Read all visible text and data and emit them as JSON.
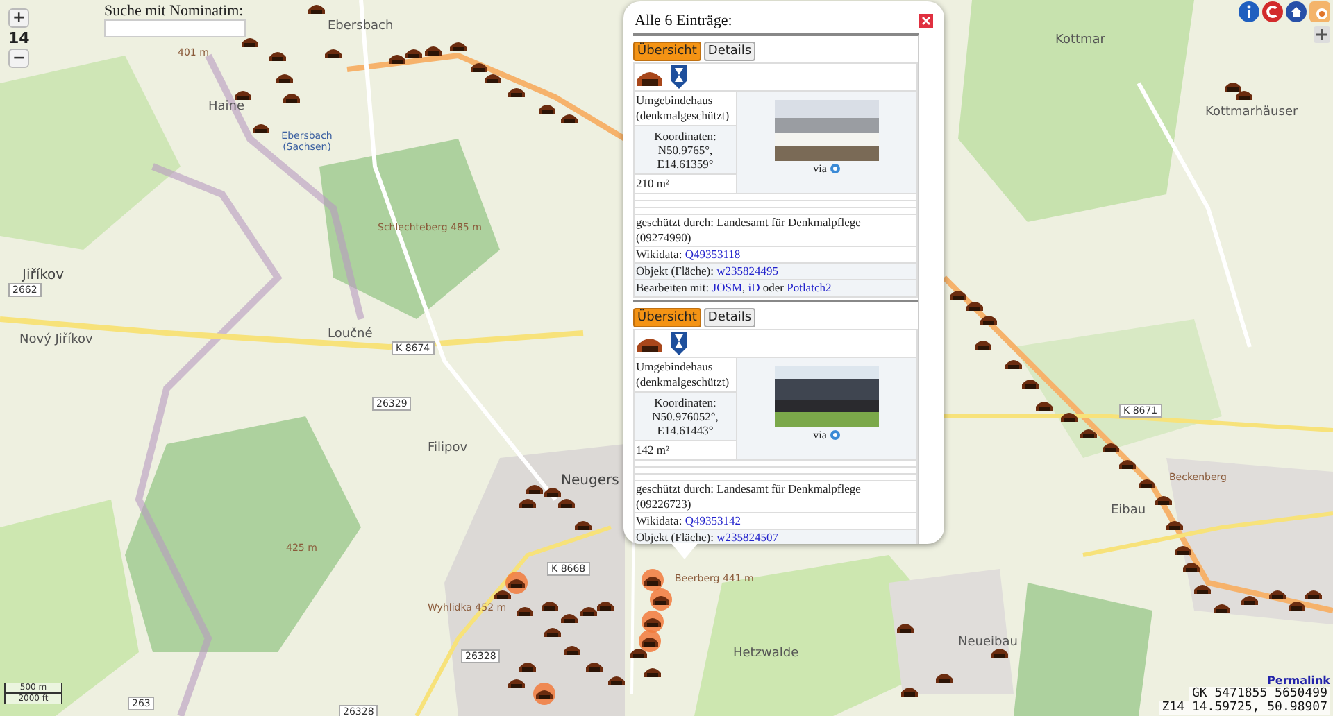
{
  "zoom_control": {
    "zoom_in": "+",
    "level": "14",
    "zoom_out": "−"
  },
  "search": {
    "label": "Suche mit Nominatim:"
  },
  "map": {
    "labels": [
      {
        "kind": "peak",
        "text": "401 m"
      },
      {
        "kind": "place",
        "text": "Haine"
      },
      {
        "kind": "place",
        "text": "Ebersbach"
      },
      {
        "kind": "poi",
        "text": "Ebersbach (Sachsen)"
      },
      {
        "kind": "peak",
        "text": "Schlechteberg 485 m"
      },
      {
        "kind": "town",
        "text": "Jiříkov"
      },
      {
        "kind": "ref",
        "text": "2662"
      },
      {
        "kind": "place",
        "text": "Nový Jiříkov"
      },
      {
        "kind": "place",
        "text": "Loučné"
      },
      {
        "kind": "ref",
        "text": "K 8674"
      },
      {
        "kind": "ref",
        "text": "26329"
      },
      {
        "kind": "place",
        "text": "Filipov"
      },
      {
        "kind": "town",
        "text": "Neugers"
      },
      {
        "kind": "peak",
        "text": "425 m"
      },
      {
        "kind": "ref",
        "text": "K 8668"
      },
      {
        "kind": "peak",
        "text": "Wyhlidka 452 m"
      },
      {
        "kind": "ref",
        "text": "26328"
      },
      {
        "kind": "ref",
        "text": "263"
      },
      {
        "kind": "ref",
        "text": "26328"
      },
      {
        "kind": "peak",
        "text": "Beerberg 441 m"
      },
      {
        "kind": "place",
        "text": "Hetzwalde"
      },
      {
        "kind": "place",
        "text": "Neueibau"
      },
      {
        "kind": "ref",
        "text": "K 8671"
      },
      {
        "kind": "place",
        "text": "Eibau"
      },
      {
        "kind": "peak",
        "text": "Beckenberg"
      },
      {
        "kind": "place",
        "text": "Kottmar"
      },
      {
        "kind": "place",
        "text": "Kottmarhäuser"
      }
    ]
  },
  "popup": {
    "title": "Alle 6 Einträge:",
    "entries": [
      {
        "tabs": [
          {
            "label": "Übersicht",
            "selected": true
          },
          {
            "label": "Details",
            "selected": false
          }
        ],
        "type": "Umgebindehaus (denkmalgeschützt)",
        "coordinates_label": "Koordinaten:",
        "latitude": "N50.9765°,",
        "longitude": "E14.61359°",
        "area": "210 m²",
        "image_via": "via",
        "protected_by": "geschützt durch: Landesamt für Denkmalpflege (09274990)",
        "wikidata_label": "Wikidata:",
        "wikidata_id": "Q49353118",
        "object_label": "Objekt (Fläche):",
        "object_id": "w235824495",
        "edit": [
          {
            "kind": "text",
            "text": "Bearbeiten mit:"
          },
          {
            "kind": "link",
            "text": "JOSM"
          },
          {
            "kind": "text",
            "text": ","
          },
          {
            "kind": "link",
            "text": "iD"
          },
          {
            "kind": "text",
            "text": "oder"
          },
          {
            "kind": "link",
            "text": "Potlatch2"
          }
        ]
      },
      {
        "tabs": [
          {
            "label": "Übersicht",
            "selected": true
          },
          {
            "label": "Details",
            "selected": false
          }
        ],
        "type": "Umgebindehaus (denkmalgeschützt)",
        "coordinates_label": "Koordinaten:",
        "latitude": "N50.976052°,",
        "longitude": "E14.61443°",
        "area": "142 m²",
        "image_via": "via",
        "protected_by": "geschützt durch: Landesamt für Denkmalpflege (09226723)",
        "wikidata_label": "Wikidata:",
        "wikidata_id": "Q49353142",
        "object_label": "Objekt (Fläche):",
        "object_id": "w235824507"
      }
    ]
  },
  "scale": {
    "metric": "500 m",
    "imperial": "2000 ft"
  },
  "permalink": "Permalink",
  "gk_coordinates": "GK 5471855 5650499",
  "position": "Z14 14.59725, 50.98907"
}
